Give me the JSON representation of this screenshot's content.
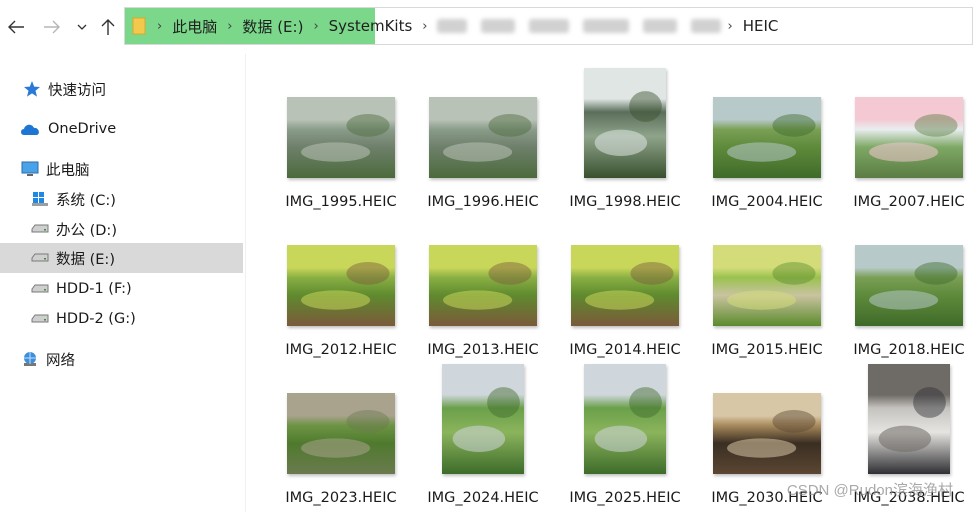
{
  "navigation": {
    "back_icon": "arrow-left-icon",
    "forward_icon": "arrow-right-icon",
    "recent_icon": "chevron-down-icon",
    "up_icon": "arrow-up-icon"
  },
  "address": {
    "crumbs": [
      "此电脑",
      "数据 (E:)",
      "SystemKits",
      "HEIC"
    ],
    "highlight_color": "#7bd88a"
  },
  "sidebar": {
    "items": [
      {
        "label": "快速访问",
        "icon": "star-icon"
      },
      {
        "label": "OneDrive",
        "icon": "cloud-icon"
      },
      {
        "label": "此电脑",
        "icon": "computer-icon"
      },
      {
        "label": "系统 (C:)",
        "icon": "windows-drive-icon"
      },
      {
        "label": "办公 (D:)",
        "icon": "drive-icon"
      },
      {
        "label": "数据 (E:)",
        "icon": "drive-icon",
        "selected": true
      },
      {
        "label": "HDD-1 (F:)",
        "icon": "drive-icon"
      },
      {
        "label": "HDD-2 (G:)",
        "icon": "drive-icon"
      },
      {
        "label": "网络",
        "icon": "network-icon"
      }
    ]
  },
  "files": [
    {
      "name": "IMG_1995.HEIC",
      "theme": "pond",
      "orientation": "landscape"
    },
    {
      "name": "IMG_1996.HEIC",
      "theme": "pond",
      "orientation": "landscape"
    },
    {
      "name": "IMG_1998.HEIC",
      "theme": "water",
      "orientation": "portrait"
    },
    {
      "name": "IMG_2004.HEIC",
      "theme": "stream",
      "orientation": "landscape"
    },
    {
      "name": "IMG_2007.HEIC",
      "theme": "flower",
      "orientation": "landscape"
    },
    {
      "name": "IMG_2012.HEIC",
      "theme": "rocks",
      "orientation": "landscape"
    },
    {
      "name": "IMG_2013.HEIC",
      "theme": "rocks",
      "orientation": "landscape"
    },
    {
      "name": "IMG_2014.HEIC",
      "theme": "rocks",
      "orientation": "landscape"
    },
    {
      "name": "IMG_2015.HEIC",
      "theme": "meadow",
      "orientation": "landscape"
    },
    {
      "name": "IMG_2018.HEIC",
      "theme": "stream",
      "orientation": "landscape"
    },
    {
      "name": "IMG_2023.HEIC",
      "theme": "fall",
      "orientation": "landscape"
    },
    {
      "name": "IMG_2024.HEIC",
      "theme": "park",
      "orientation": "portrait"
    },
    {
      "name": "IMG_2025.HEIC",
      "theme": "park",
      "orientation": "portrait"
    },
    {
      "name": "IMG_2030.HEIC",
      "theme": "indoor",
      "orientation": "landscape"
    },
    {
      "name": "IMG_2038.HEIC",
      "theme": "room",
      "orientation": "portrait"
    }
  ],
  "watermark": "CSDN @Rudon滨海渔村"
}
